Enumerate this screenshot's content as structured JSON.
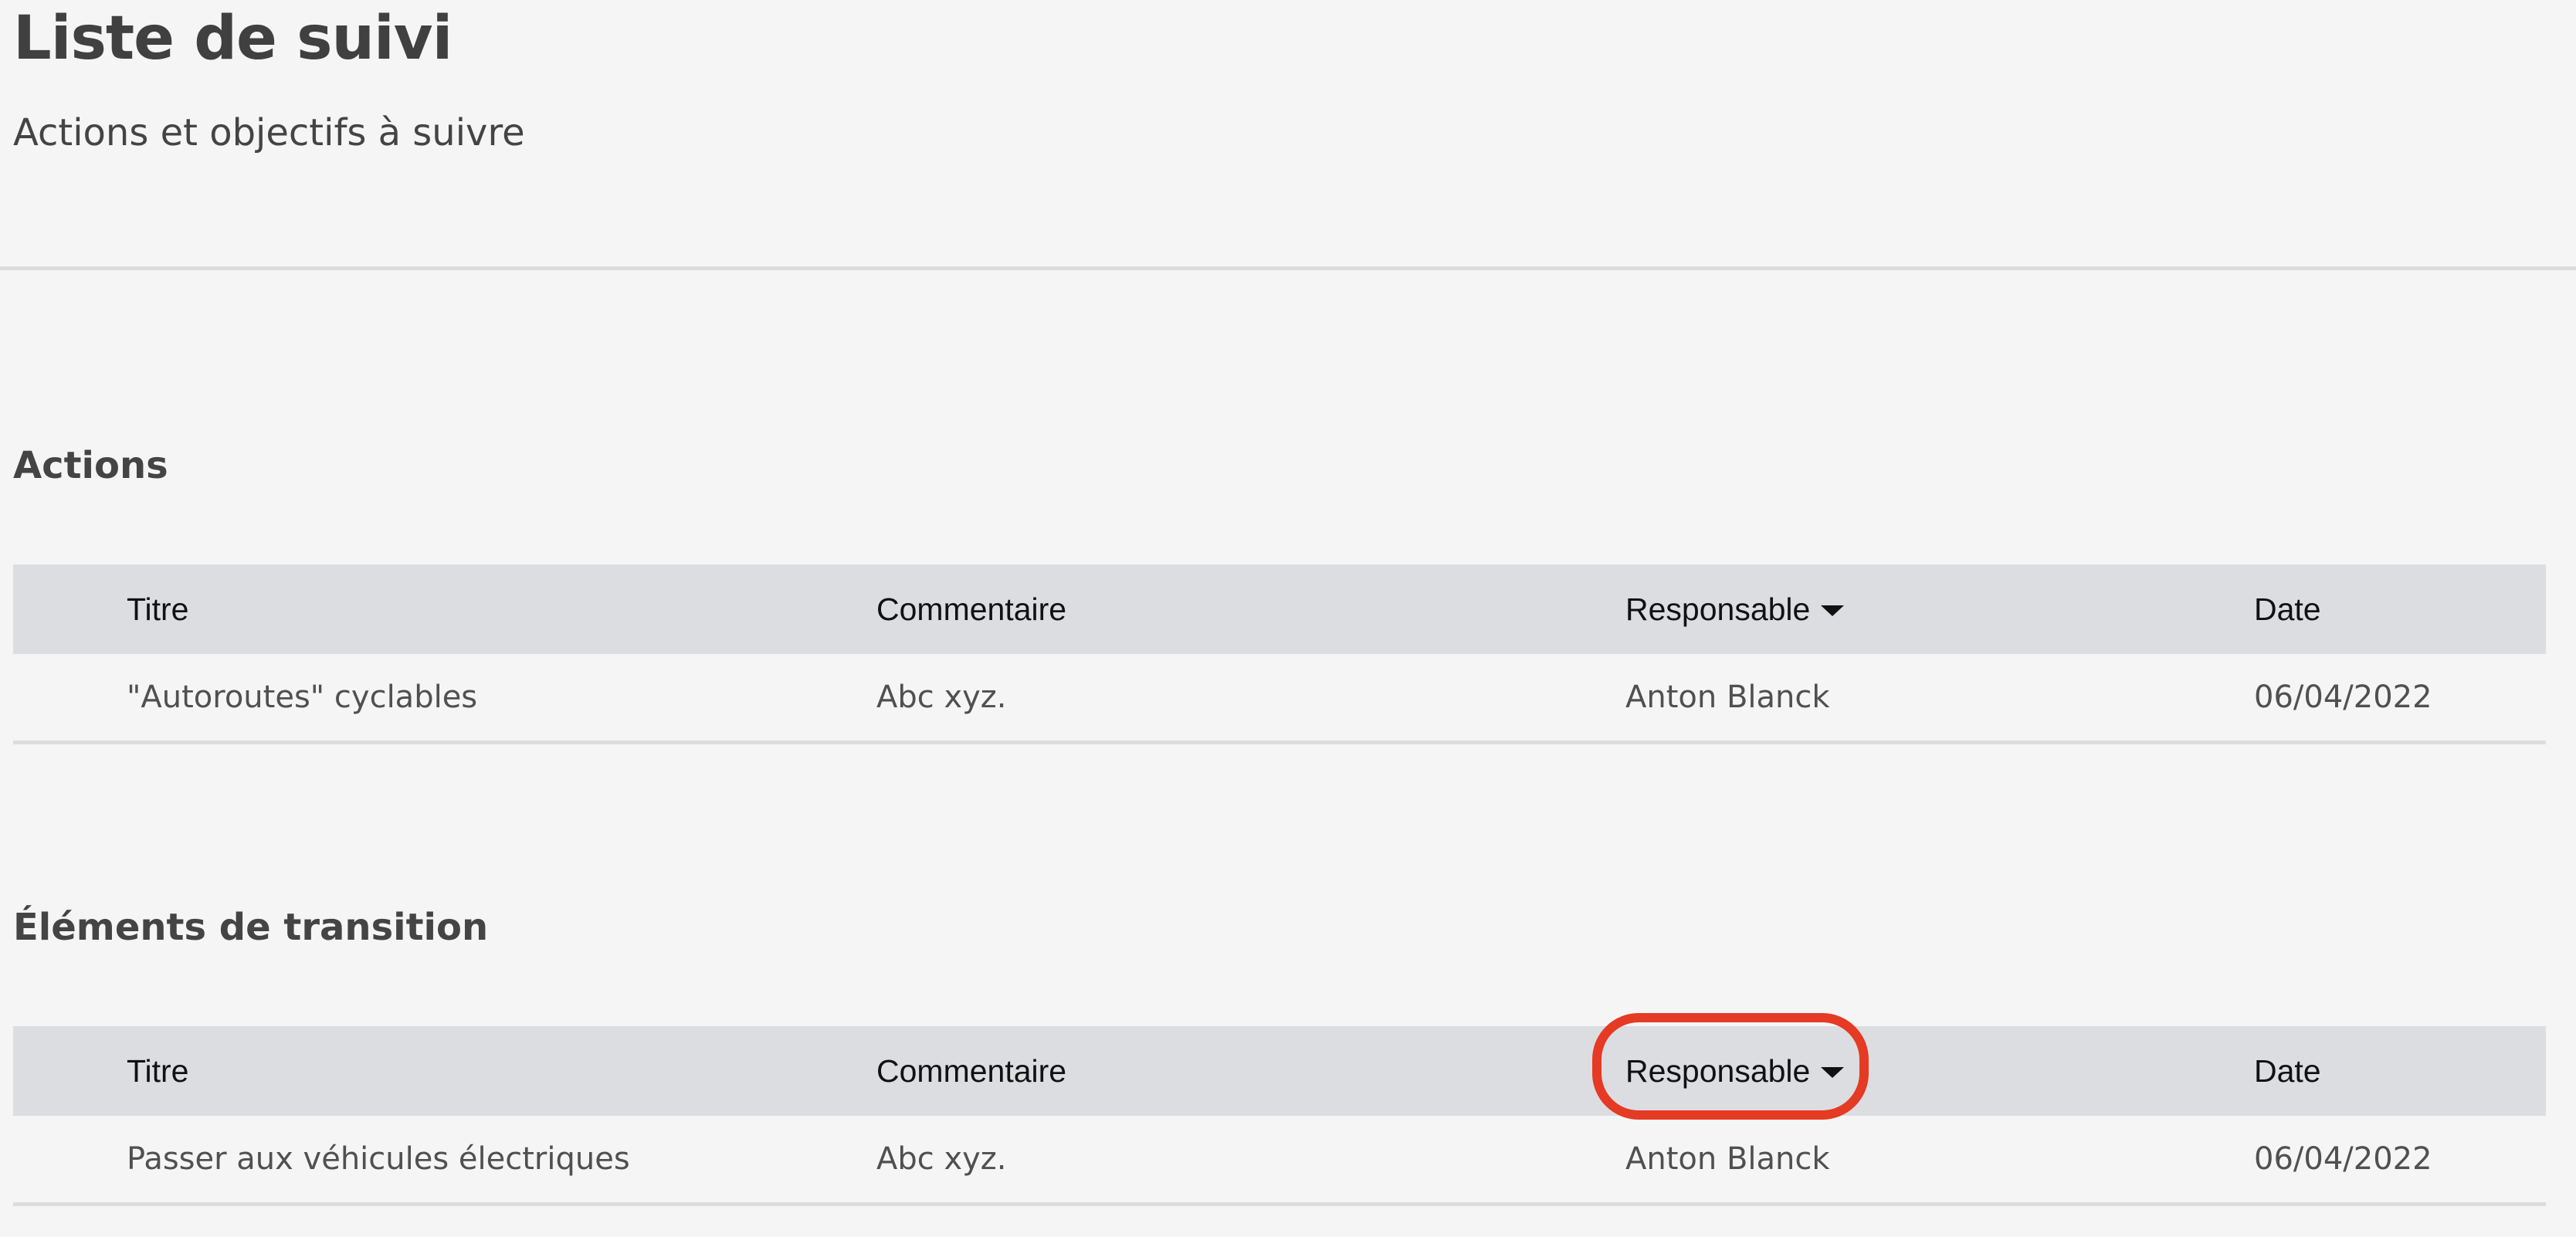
{
  "header": {
    "title": "Liste de suivi",
    "subtitle": "Actions et objectifs à suivre"
  },
  "columns": {
    "title": "Titre",
    "comment": "Commentaire",
    "owner": "Responsable",
    "date": "Date"
  },
  "sections": [
    {
      "title": "Actions",
      "rows": [
        {
          "title": "\"Autoroutes\" cyclables",
          "comment": "Abc xyz.",
          "owner": "Anton Blanck",
          "date": "06/04/2022"
        }
      ]
    },
    {
      "title": "Éléments de transition",
      "rows": [
        {
          "title": "Passer aux véhicules électriques",
          "comment": "Abc xyz.",
          "owner": "Anton Blanck",
          "date": "06/04/2022"
        }
      ]
    }
  ],
  "icons": {
    "sort": "caret-down-icon"
  },
  "colors": {
    "highlight": "#e53a24",
    "header_bg": "#dcdde1",
    "background": "#f5f5f5"
  }
}
